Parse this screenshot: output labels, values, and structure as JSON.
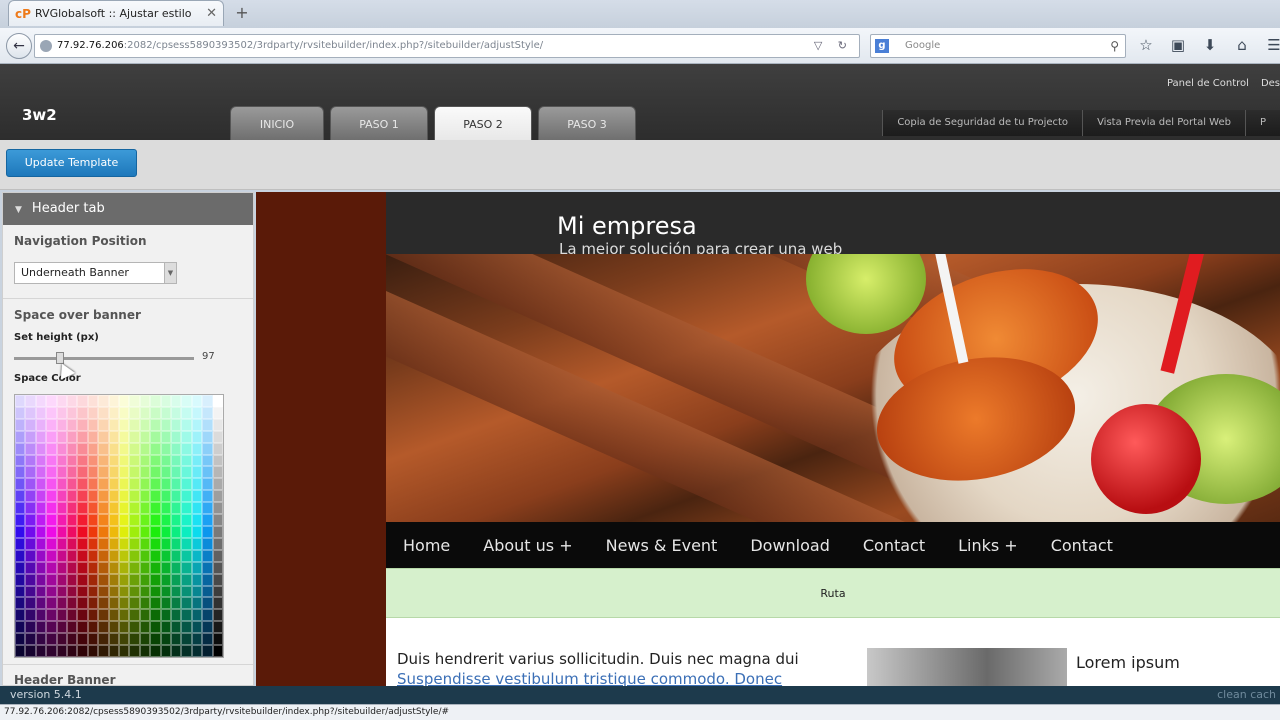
{
  "browser": {
    "tab_title": "RVGlobalsoft :: Ajustar estilo",
    "tab_favicon": "cP",
    "url_host": "77.92.76.206",
    "url_rest": ":2082/cpsess5890393502/3rdparty/rvsitebuilder/index.php?/sitebuilder/adjustStyle/",
    "search_placeholder": "Google",
    "status_url": "77.92.76.206:2082/cpsess5890393502/3rdparty/rvsitebuilder/index.php?/sitebuilder/adjustStyle/#"
  },
  "app": {
    "brand": "3w2",
    "top_links": [
      "Panel de Control",
      "Des"
    ],
    "steps": [
      "INICIO",
      "PASO 1",
      "PASO 2",
      "PASO 3"
    ],
    "active_step": "PASO 2",
    "action_links": [
      "Copia de Seguridad de tu Projecto",
      "Vista Previa del Portal Web",
      "P"
    ],
    "update_button": "Update Template",
    "version": "version 5.4.1",
    "version_right": "clean cach"
  },
  "panel": {
    "header": "Header tab",
    "nav_position_label": "Navigation Position",
    "nav_position_value": "Underneath Banner",
    "space_over_banner": "Space over banner",
    "set_height_label": "Set height (px)",
    "height_value": "97",
    "height_fraction": 0.24,
    "space_color_label": "Space Color",
    "next_section": "Header Banner"
  },
  "preview": {
    "site_name": "Mi empresa",
    "site_tagline": "La mejor solución para crear una web",
    "menu": [
      "Home",
      "About us +",
      "News & Event",
      "Download",
      "Contact",
      "Links +",
      "Contact"
    ],
    "breadcrumb": "Ruta",
    "para_line1": "Duis hendrerit varius sollicitudin. Duis nec magna dui",
    "para_line2": "Suspendisse vestibulum tristique commodo. Donec",
    "sidebar_heading": "Lorem ipsum"
  }
}
